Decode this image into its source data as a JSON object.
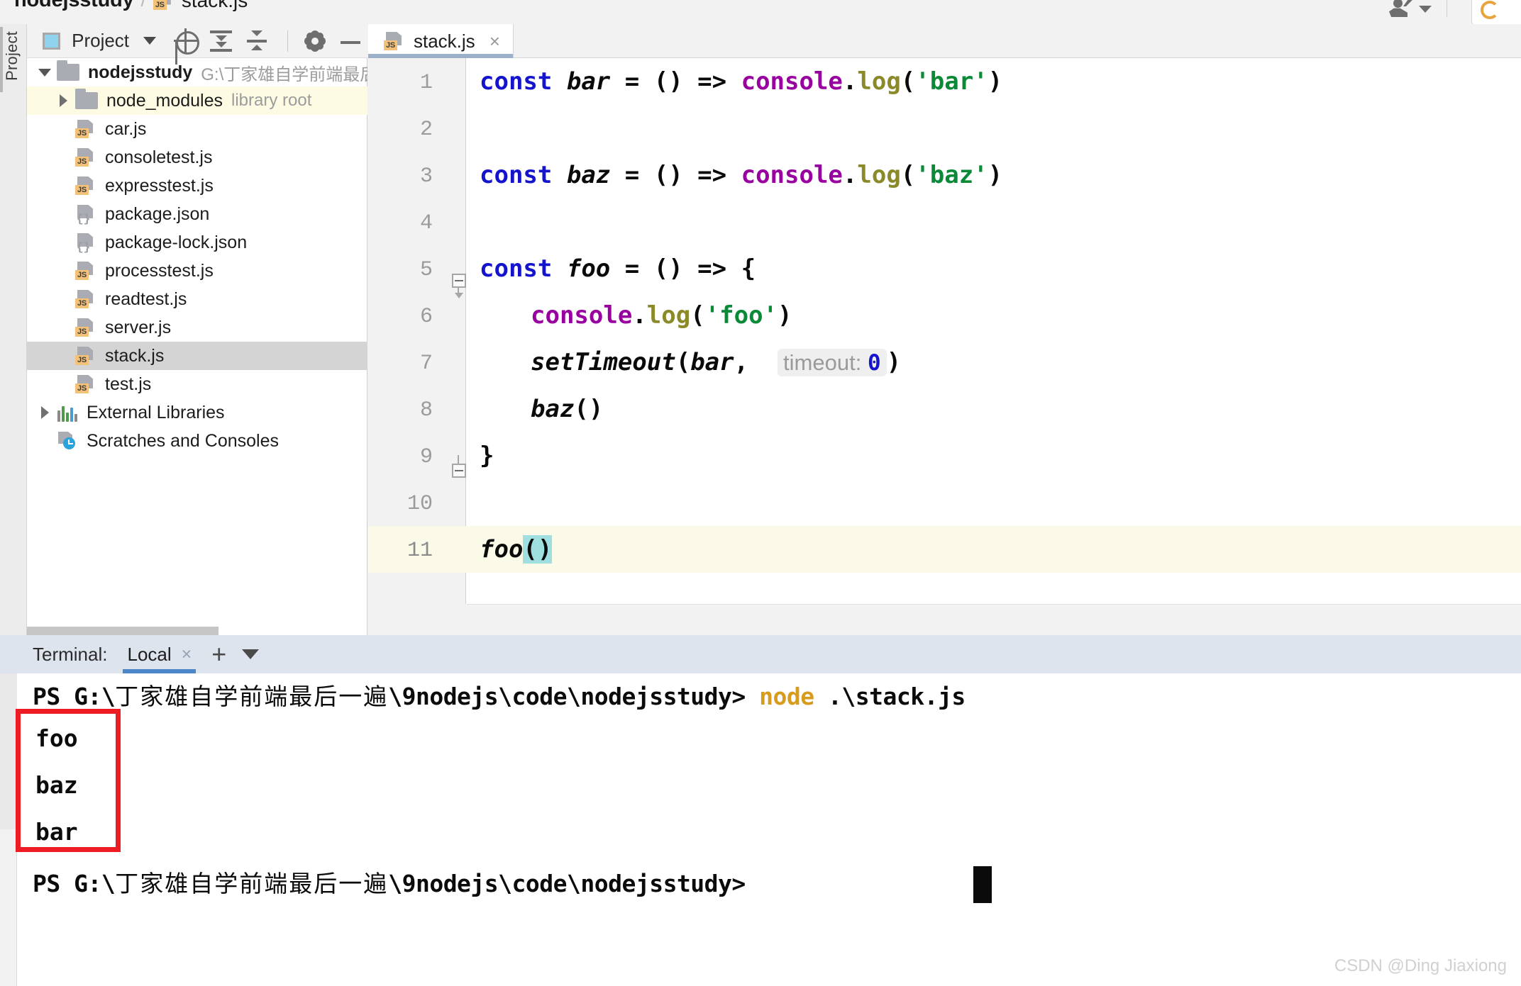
{
  "breadcrumb": {
    "project": "nodejsstudy",
    "separator": "/",
    "file": "stack.js",
    "file_icon": "js-file-icon"
  },
  "titlebar": {
    "user_icon": "user-avatar-icon",
    "user_caret": "chevron-down-icon",
    "run_icon": "run-ring-icon"
  },
  "left_strip": {
    "label": "Project"
  },
  "project_panel": {
    "toolbar": {
      "title": "Project",
      "dropdown_caret": "chevron-down-icon",
      "icons": [
        {
          "name": "locate-icon",
          "title": "Select Opened File"
        },
        {
          "name": "expand-all-icon",
          "title": "Expand All"
        },
        {
          "name": "collapse-all-icon",
          "title": "Collapse All"
        },
        {
          "name": "gear-icon",
          "title": "Settings"
        },
        {
          "name": "minimize-icon",
          "title": "Hide"
        }
      ]
    },
    "tree": [
      {
        "label": "nodejsstudy",
        "sublabel": "G:\\丁家雄自学前端最后",
        "icon": "folder-icon",
        "twist": "down",
        "depth": 0,
        "bold": true,
        "state": "normal"
      },
      {
        "label": "node_modules",
        "sublabel": "library root",
        "icon": "folder-icon",
        "twist": "right",
        "depth": 1,
        "bold": false,
        "state": "yellow"
      },
      {
        "label": "car.js",
        "sublabel": "",
        "icon": "js-file-icon",
        "twist": "none",
        "depth": 2,
        "bold": false,
        "state": "normal"
      },
      {
        "label": "consoletest.js",
        "sublabel": "",
        "icon": "js-file-icon",
        "twist": "none",
        "depth": 2,
        "bold": false,
        "state": "normal"
      },
      {
        "label": "expresstest.js",
        "sublabel": "",
        "icon": "js-file-icon",
        "twist": "none",
        "depth": 2,
        "bold": false,
        "state": "normal"
      },
      {
        "label": "package.json",
        "sublabel": "",
        "icon": "json-file-icon",
        "twist": "none",
        "depth": 2,
        "bold": false,
        "state": "normal"
      },
      {
        "label": "package-lock.json",
        "sublabel": "",
        "icon": "json-file-icon",
        "twist": "none",
        "depth": 2,
        "bold": false,
        "state": "normal"
      },
      {
        "label": "processtest.js",
        "sublabel": "",
        "icon": "js-file-icon",
        "twist": "none",
        "depth": 2,
        "bold": false,
        "state": "normal"
      },
      {
        "label": "readtest.js",
        "sublabel": "",
        "icon": "js-file-icon",
        "twist": "none",
        "depth": 2,
        "bold": false,
        "state": "normal"
      },
      {
        "label": "server.js",
        "sublabel": "",
        "icon": "js-file-icon",
        "twist": "none",
        "depth": 2,
        "bold": false,
        "state": "normal"
      },
      {
        "label": "stack.js",
        "sublabel": "",
        "icon": "js-file-icon",
        "twist": "none",
        "depth": 2,
        "bold": false,
        "state": "selected"
      },
      {
        "label": "test.js",
        "sublabel": "",
        "icon": "js-file-icon",
        "twist": "none",
        "depth": 2,
        "bold": false,
        "state": "normal"
      },
      {
        "label": "External Libraries",
        "sublabel": "",
        "icon": "libraries-icon",
        "twist": "right",
        "depth": 0,
        "bold": false,
        "state": "normal"
      },
      {
        "label": "Scratches and Consoles",
        "sublabel": "",
        "icon": "scratches-icon",
        "twist": "none",
        "depth": 0,
        "bold": false,
        "state": "normal"
      }
    ]
  },
  "editor": {
    "tab": {
      "name": "stack.js",
      "close": "×",
      "icon": "js-file-icon"
    },
    "line_numbers": [
      "1",
      "2",
      "3",
      "4",
      "5",
      "6",
      "7",
      "8",
      "9",
      "10",
      "11"
    ],
    "active_line": 11,
    "inlay_hint": {
      "label": "timeout:",
      "value": "0"
    },
    "selection_text": "()",
    "code_lines": [
      "const bar = () => console.log('bar')",
      "",
      "const baz = () => console.log('baz')",
      "",
      "const foo = () => {",
      "    console.log('foo')",
      "    setTimeout(bar, 0)",
      "    baz()",
      "}",
      "",
      "foo()"
    ],
    "tokens": {
      "keyword": "const",
      "identifiers": [
        "bar",
        "baz",
        "foo",
        "setTimeout"
      ],
      "object": "console",
      "method": "log",
      "strings": [
        "'bar'",
        "'baz'",
        "'foo'"
      ],
      "arrow": "=>"
    },
    "colors": {
      "keyword": "#1414CC",
      "object": "#9900A0",
      "method": "#8A8A2B",
      "string": "#0A8A36",
      "number": "#1414CC",
      "plain": "#0A0A0A",
      "inlay_bg": "#EFEFEF",
      "inlay_text": "#9A9A9A",
      "selection": "#9FDFDF",
      "active_line_bg": "#FBF9E8"
    }
  },
  "terminal": {
    "header": {
      "label": "Terminal:",
      "tab_name": "Local",
      "tab_close": "×",
      "add_icon": "plus-icon",
      "dropdown_icon": "chevron-down-icon"
    },
    "lines": [
      {
        "type": "prompt",
        "prefix": "PS G:\\",
        "cn": "丁家雄自学前端最后一遍",
        "path": "\\9nodejs\\code\\nodejsstudy>",
        "command_cmd": "node",
        "command_arg": " .\\stack.js"
      },
      {
        "type": "output",
        "text": "foo"
      },
      {
        "type": "output",
        "text": "baz"
      },
      {
        "type": "output",
        "text": "bar"
      },
      {
        "type": "prompt",
        "prefix": "PS G:\\",
        "cn": "丁家雄自学前端最后一遍",
        "path": "\\9nodejs\\code\\nodejsstudy>",
        "command_cmd": "",
        "command_arg": ""
      }
    ],
    "annotation": {
      "name": "red-highlight-box",
      "color": "#ED1C24"
    },
    "cursor": "block-cursor"
  },
  "watermark": "CSDN @Ding Jiaxiong"
}
